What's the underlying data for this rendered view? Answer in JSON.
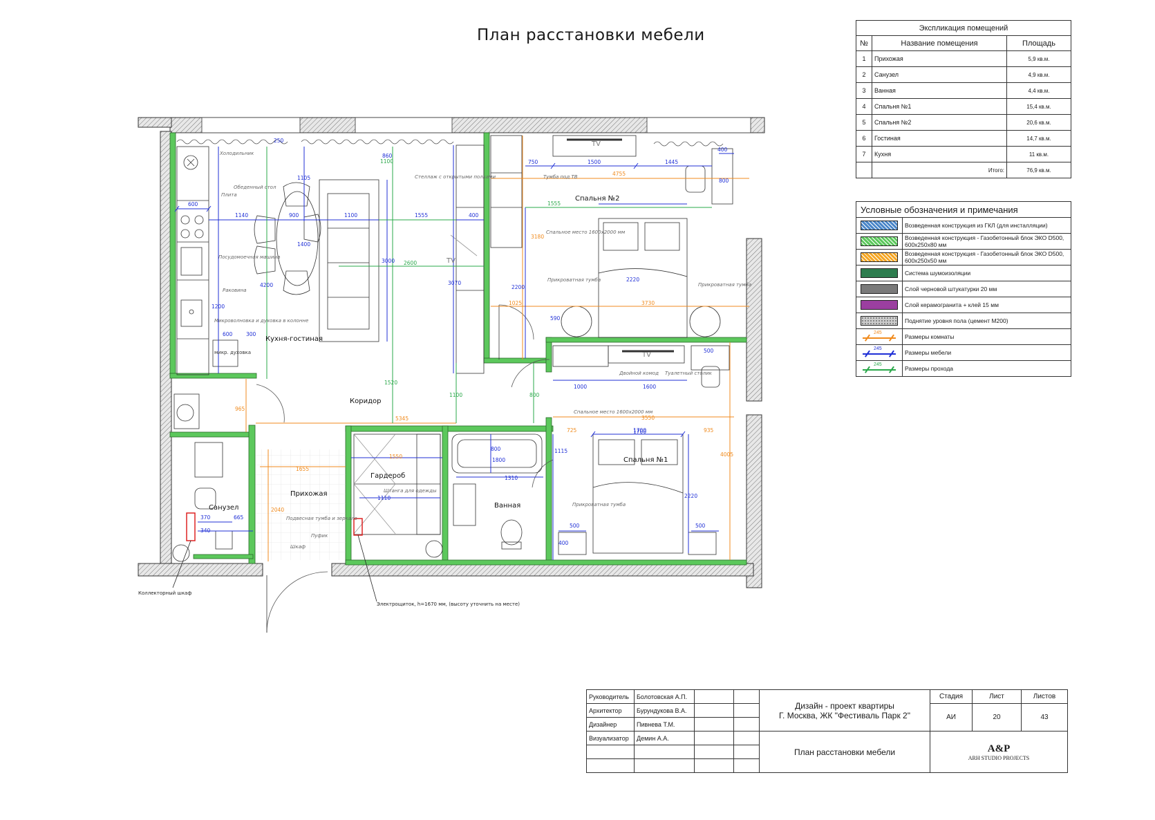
{
  "title": "План расстановки мебели",
  "explication": {
    "title": "Экспликация помещений",
    "columns": [
      "№",
      "Название помещения",
      "Площадь"
    ],
    "rows": [
      {
        "num": "1",
        "name": "Прихожая",
        "area": "5,9 кв.м."
      },
      {
        "num": "2",
        "name": "Санузел",
        "area": "4,9 кв.м."
      },
      {
        "num": "3",
        "name": "Ванная",
        "area": "4,4 кв.м."
      },
      {
        "num": "4",
        "name": "Спальня №1",
        "area": "15,4 кв.м."
      },
      {
        "num": "5",
        "name": "Спальня №2",
        "area": "20,6 кв.м."
      },
      {
        "num": "6",
        "name": "Гостиная",
        "area": "14,7 кв.м."
      },
      {
        "num": "7",
        "name": "Кухня",
        "area": "11 кв.м."
      }
    ],
    "total_label": "Итого:",
    "total_value": "76,9 кв.м."
  },
  "legend": {
    "title": "Условные обозначения и примечания",
    "items": [
      {
        "label": "Возведенная конструкция из ГКЛ (для инсталляции)",
        "color": "#4a86c8",
        "kind": "hatch"
      },
      {
        "label": "Возведенная конструкция - Газобетонный блок ЭКО D500, 600x250x80 мм",
        "color": "#5cc85c",
        "kind": "hatch"
      },
      {
        "label": "Возведенная конструкция - Газобетонный блок ЭКО D500, 600x250x50 мм",
        "color": "#f5a623",
        "kind": "hatch"
      },
      {
        "label": "Система шумоизоляции",
        "color": "#2e7d4f",
        "kind": "fill"
      },
      {
        "label": "Слой черновой штукатурки 20 мм",
        "color": "#7a7a7a",
        "kind": "fill"
      },
      {
        "label": "Слой керамогранита + клей 15 мм",
        "color": "#9b3fa0",
        "kind": "fill"
      },
      {
        "label": "Поднятие уровня пола (цемент М200)",
        "color": "#cccccc",
        "kind": "dots"
      },
      {
        "label": "Размеры комнаты",
        "color": "#f08a1c",
        "kind": "dim",
        "num": "245"
      },
      {
        "label": "Размеры мебели",
        "color": "#1f2fd6",
        "kind": "dim",
        "num": "245"
      },
      {
        "label": "Размеры прохода",
        "color": "#2aa84a",
        "kind": "dim",
        "num": "245"
      }
    ]
  },
  "plan": {
    "rooms": {
      "kitchen_living": "Кухня-гостиная",
      "corridor": "Коридор",
      "bedroom2": "Спальня №2",
      "bedroom1": "Спальня №1",
      "wardrobe": "Гардероб",
      "hallway": "Прихожая",
      "wc": "Санузел",
      "bath": "Ванная"
    },
    "notes": {
      "fridge": "Холодильник",
      "dining": "Обеденный стол",
      "stove": "Плита",
      "dishwasher": "Посудомоечная машина",
      "sink": "Раковина",
      "micro": "Микроволновка и духовка в колонне",
      "shelf": "Стеллаж с открытыми полками",
      "tv_stand": "Тумба под ТВ",
      "bed2": "Спальное место 1600x2000 мм",
      "bed1": "Спальное место 1600x2000 мм",
      "nightstand": "Прикроватная тумба",
      "dresser": "Двойной комод",
      "vanity": "Туалетный столик",
      "hall_unit": "Подвесная тумба и зеркало",
      "pouf": "Пуфик",
      "cabinet": "Шкаф",
      "shelves_w": "Штанга для одежды",
      "collector": "Коллекторный шкаф",
      "panel": "Электрощиток, h=1670 мм, (высоту уточнить на месте)",
      "micro_box": "микр. духовка"
    },
    "tv": "TV",
    "dims_orange": [
      "4755",
      "3730",
      "3550",
      "5345",
      "1025",
      "725",
      "935",
      "1655",
      "2040",
      "965",
      "1550",
      "3180",
      "4005"
    ],
    "dims_blue": [
      "600",
      "1140",
      "900",
      "1100",
      "1555",
      "400",
      "750",
      "1500",
      "1445",
      "400",
      "800",
      "500",
      "1700",
      "2200",
      "2220",
      "590",
      "1000",
      "1600",
      "500",
      "1700",
      "2220",
      "400",
      "500",
      "370",
      "665",
      "340",
      "1310",
      "1800",
      "1110",
      "1115",
      "3000",
      "3070",
      "4200",
      "1400",
      "1105",
      "860",
      "300",
      "600",
      "800",
      "250",
      "1200"
    ],
    "dims_green": [
      "1555",
      "2600",
      "1520",
      "1100",
      "1100",
      "800"
    ]
  },
  "stamp": {
    "roles": [
      {
        "role": "Руководитель",
        "name": "Болотовская А.П."
      },
      {
        "role": "Архитектор",
        "name": "Бурундукова В.А."
      },
      {
        "role": "Дизайнер",
        "name": "Пивнева Т.М."
      },
      {
        "role": "Визуализатор",
        "name": "Демин А.А."
      }
    ],
    "project_line1": "Дизайн - проект квартиры",
    "project_line2": "Г. Москва, ЖК \"Фестиваль Парк 2\"",
    "sheet_title": "План расстановки мебели",
    "stage_label": "Стадия",
    "sheet_label": "Лист",
    "sheets_label": "Листов",
    "stage": "АИ",
    "sheet": "20",
    "sheets": "43",
    "firm_logo": "A&P",
    "firm_name": "ARH STUDIO PROJECTS"
  }
}
